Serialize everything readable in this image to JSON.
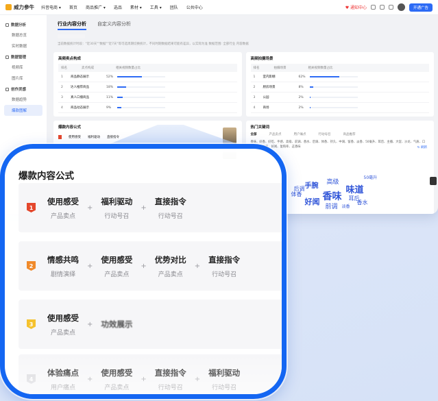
{
  "app": {
    "logo": "威力参牛",
    "nav": [
      "抖音电商 ▾",
      "首页",
      "商品推广 ▾",
      "选品",
      "素材 ▾",
      "工具 ▾",
      "团队",
      "公共中心"
    ],
    "top_right": {
      "notify": "♥ 通知中心",
      "action_button": "开通广告"
    },
    "sidebar": [
      {
        "group": "数据分析",
        "items": [
          "数据总览",
          "实时数据"
        ]
      },
      {
        "group": "数据管理",
        "items": [
          "视频库",
          "图片库"
        ]
      },
      {
        "group": "创作灵感",
        "items": [
          "数据趋势",
          "爆款图解"
        ]
      }
    ],
    "active_side_item": "爆款图解",
    "tabs": [
      "行业内容分析",
      "自定义内容分析"
    ],
    "hint_text": "当前数据统计时段：\"近30天\"\"数据\"\"近7天\"等可选周期切换统计，不同时期数据结果可能有差异，以实际为准  数据范围: 全部行业 内容数据",
    "left_panel": {
      "title": "高频卖点构成",
      "headers": [
        "排名",
        "卖点构成",
        "相关视频数量占比"
      ],
      "rows": [
        {
          "rank": "1",
          "name": "商品静态展示",
          "pct": "52%",
          "value": 0.52
        },
        {
          "rank": "2",
          "name": "达人推荐商品",
          "pct": "18%",
          "value": 0.18
        },
        {
          "rank": "3",
          "name": "真人口播商品",
          "pct": "11%",
          "value": 0.11
        },
        {
          "rank": "4",
          "name": "商品动态展示",
          "pct": "9%",
          "value": 0.09
        }
      ]
    },
    "right_panel": {
      "title": "高频拍摄场景",
      "headers": [
        "排名",
        "拍摄场景",
        "相关视频数量占比"
      ],
      "rows": [
        {
          "rank": "1",
          "name": "室内影棚",
          "pct": "62%",
          "value": 0.62
        },
        {
          "rank": "2",
          "name": "厨房场景",
          "pct": "8%",
          "value": 0.08
        },
        {
          "rank": "3",
          "name": "公园",
          "pct": "2%",
          "value": 0.02
        },
        {
          "rank": "4",
          "name": "商场",
          "pct": "2%",
          "value": 0.02
        }
      ]
    },
    "formula_panel": {
      "title": "爆款内容公式",
      "mini": [
        {
          "main": "使用感受",
          "sub": "产品卖点"
        },
        {
          "main": "福利驱动",
          "sub": "行动号召"
        },
        {
          "main": "直接指令",
          "sub": "行动号召"
        }
      ]
    },
    "keyword_panel": {
      "title": "热门关键词",
      "tabs": [
        "全部",
        "产品卖点",
        "用户痛点",
        "行动号召",
        "商品推荐"
      ],
      "list": "香味、好香、好吃、手感、高级、前调、香水、后调、体香、持久、中调、留香、淡香、50毫升、耳后、主播、大促、沙龙、气质、口碑、香水分享、好闻、复购率、这香味",
      "refresh": "↻ 刷新",
      "cloud": [
        {
          "w": "香味",
          "s": 14
        },
        {
          "w": "味道",
          "s": 13
        },
        {
          "w": "好闻",
          "s": 11
        },
        {
          "w": "手腕",
          "s": 10
        },
        {
          "w": "高级",
          "s": 9
        },
        {
          "w": "前调",
          "s": 9
        },
        {
          "w": "后调",
          "s": 8
        },
        {
          "w": "体香",
          "s": 8
        },
        {
          "w": "耳后",
          "s": 8
        },
        {
          "w": "香水",
          "s": 8
        },
        {
          "w": "50毫升",
          "s": 6
        },
        {
          "w": "淡香",
          "s": 6
        }
      ]
    }
  },
  "card": {
    "title": "爆款内容公式",
    "rows": [
      {
        "rank": "1",
        "terms": [
          {
            "main": "使用感受",
            "sub": "产品卖点"
          },
          {
            "main": "福利驱动",
            "sub": "行动号召"
          },
          {
            "main": "直接指令",
            "sub": "行动号召"
          }
        ]
      },
      {
        "rank": "2",
        "terms": [
          {
            "main": "情感共鸣",
            "sub": "剧情演绎"
          },
          {
            "main": "使用感受",
            "sub": "产品卖点"
          },
          {
            "main": "优势对比",
            "sub": "产品卖点"
          },
          {
            "main": "直接指令",
            "sub": "行动号召"
          }
        ]
      },
      {
        "rank": "3",
        "terms": [
          {
            "main": "使用感受",
            "sub": "产品卖点"
          },
          {
            "main": "功效展示",
            "sub": ""
          }
        ]
      },
      {
        "rank": "4",
        "terms": [
          {
            "main": "体验痛点",
            "sub": "用户痛点"
          },
          {
            "main": "使用感受",
            "sub": "产品卖点"
          },
          {
            "main": "直接指令",
            "sub": "行动号召"
          },
          {
            "main": "福利驱动",
            "sub": "行动号召"
          }
        ]
      }
    ]
  },
  "colors": {
    "accent": "#1466f2",
    "rank1": "#e4472c",
    "rank2": "#f08a2b",
    "rank3": "#f5c22e"
  }
}
